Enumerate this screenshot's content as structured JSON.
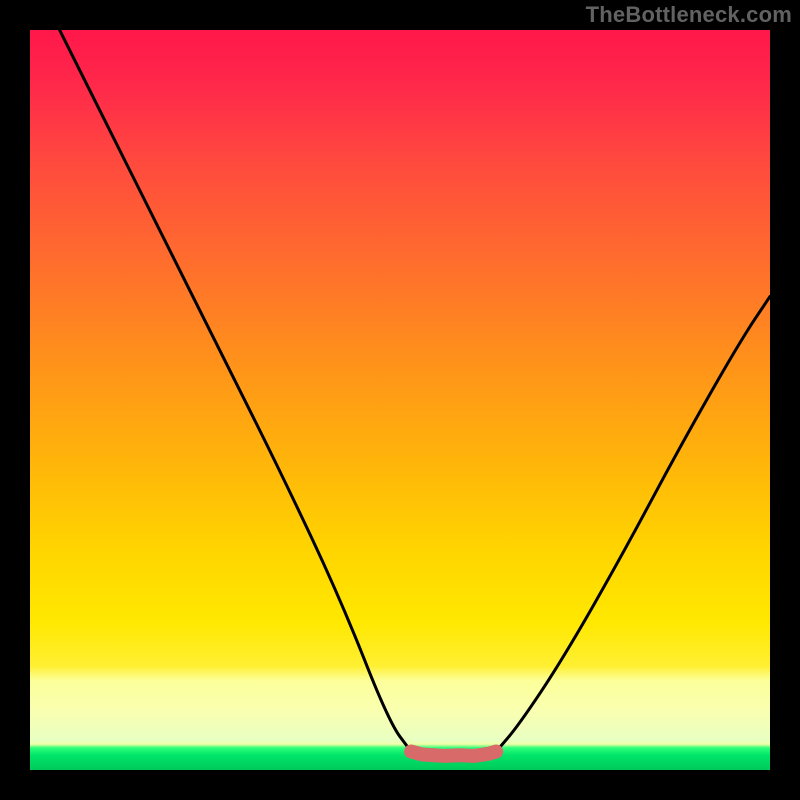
{
  "watermark": "TheBottleneck.com",
  "chart_data": {
    "type": "line",
    "title": "",
    "xlabel": "",
    "ylabel": "",
    "xlim": [
      0,
      100
    ],
    "ylim": [
      0,
      100
    ],
    "series": [
      {
        "name": "left-curve",
        "x": [
          4,
          10,
          18,
          26,
          34,
          42,
          48.5,
          51.5
        ],
        "values": [
          100,
          88,
          72,
          56,
          40,
          23,
          6.5,
          2.5
        ]
      },
      {
        "name": "right-curve",
        "x": [
          63,
          66,
          72,
          80,
          88,
          96,
          100
        ],
        "values": [
          2.5,
          6,
          15,
          29,
          44,
          58,
          64
        ]
      },
      {
        "name": "flat-segment",
        "x": [
          51.5,
          53,
          56,
          58,
          60,
          62,
          63
        ],
        "values": [
          2.5,
          2.1,
          1.9,
          2.0,
          1.9,
          2.2,
          2.5
        ],
        "stroke": "#d86a6a",
        "width": 14
      }
    ],
    "plateau": {
      "x_start": 51.5,
      "x_end": 63,
      "y": 2.2
    },
    "background": {
      "type": "vertical-gradient",
      "stops": [
        {
          "pos": 0.0,
          "color": "#ff174a"
        },
        {
          "pos": 0.45,
          "color": "#ff921a"
        },
        {
          "pos": 0.8,
          "color": "#ffe800"
        },
        {
          "pos": 0.94,
          "color": "#f9ffb0"
        },
        {
          "pos": 0.97,
          "color": "#2eff7a"
        },
        {
          "pos": 1.0,
          "color": "#00c95b"
        }
      ]
    }
  }
}
